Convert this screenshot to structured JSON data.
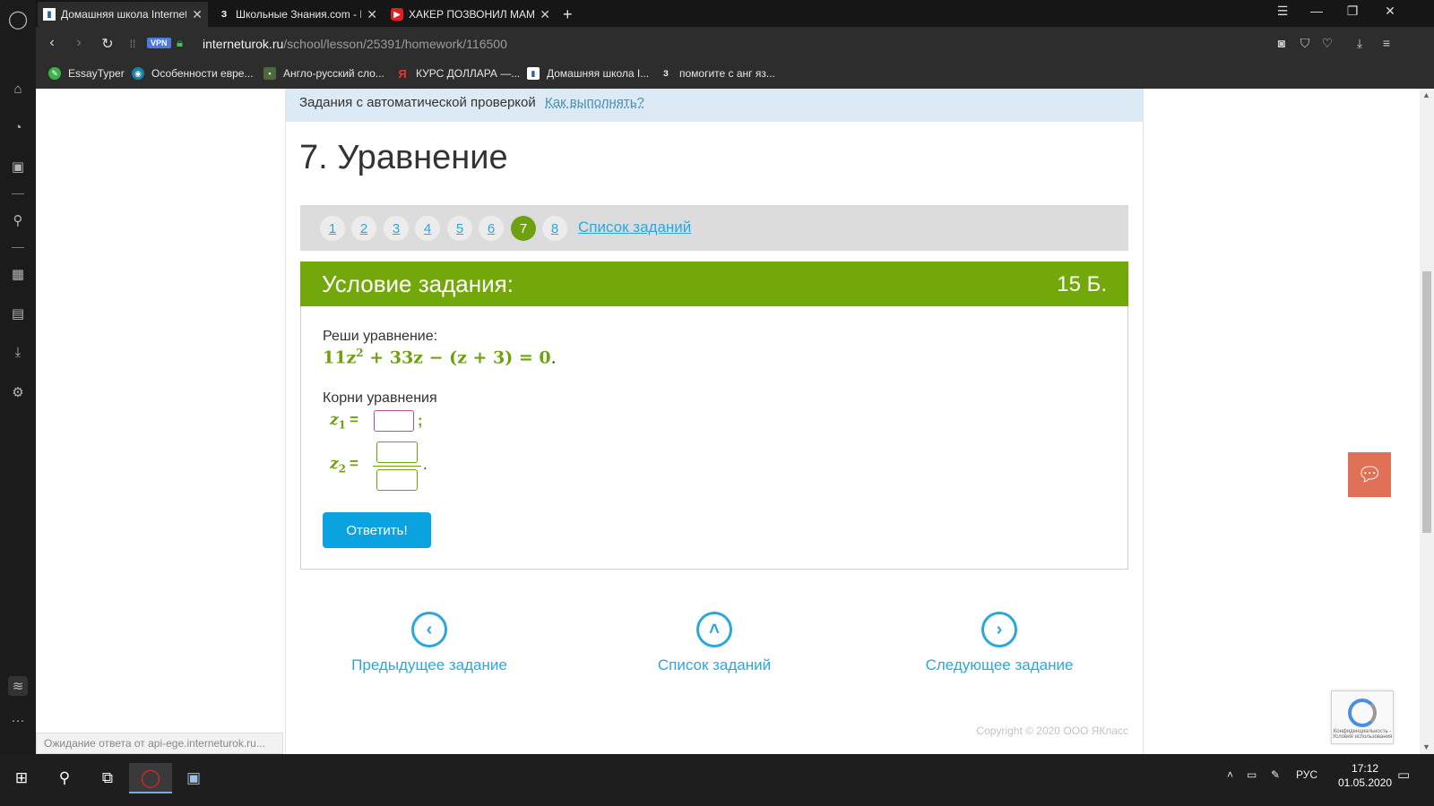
{
  "browser": {
    "tabs": [
      {
        "title": "Домашняя школа Internet",
        "favicon": "interneturok-favicon",
        "active": true
      },
      {
        "title": "Школьные Знания.com - Р",
        "favicon": "znanija-favicon",
        "active": false
      },
      {
        "title": "ХАКЕР ПОЗВОНИЛ МАМЕ",
        "favicon": "youtube-favicon",
        "active": false
      }
    ],
    "new_tab": "+",
    "vpn_badge": "VPN",
    "url_host": "interneturok.ru",
    "url_path": "/school/lesson/25391/homework/116500",
    "bookmarks": [
      {
        "label": "EssayTyper",
        "icon": "essaytyper-icon"
      },
      {
        "label": "Особенности евре...",
        "icon": "bookmark-globe-icon"
      },
      {
        "label": "Англо-русский сло...",
        "icon": "dictionary-icon"
      },
      {
        "label": "КУРС ДОЛЛАРА —...",
        "icon": "yandex-icon"
      },
      {
        "label": "Домашняя школа I...",
        "icon": "interneturok-favicon"
      },
      {
        "label": "помогите с анг яз...",
        "icon": "znanija-favicon"
      }
    ]
  },
  "page": {
    "info_text": "Задания с автоматической проверкой",
    "how_link": "Как выполнять?",
    "task_title": "7. Уравнение",
    "pager": [
      "1",
      "2",
      "3",
      "4",
      "5",
      "6",
      "7",
      "8"
    ],
    "current_page": "7",
    "task_list_link": "Список заданий",
    "condition_title": "Условие задания:",
    "points": "15 Б.",
    "solve_label": "Реши уравнение:",
    "equation_pre": "11z",
    "equation_exp": "2",
    "equation_post": " + 33z − (z + 3) = 0",
    "equation_end": ".",
    "roots_label": "Корни уравнения",
    "z1_label": "z",
    "z1_sub": "1",
    "z2_label": "z",
    "z2_sub": "2",
    "equals": "=",
    "z1_sep": ";",
    "z2_end": ".",
    "z1_value": "",
    "z2_num_value": "",
    "z2_den_value": "",
    "submit_label": "Ответить!",
    "prev_label": "Предыдущее задание",
    "list_label": "Список заданий",
    "next_label": "Следующее задание",
    "copyright": "Copyright © 2020 ООО ЯКласс",
    "status_text": "Ожидание ответа от api-ege.interneturok.ru...",
    "recaptcha_text": "Конфиденциальность - Условия использования"
  },
  "taskbar": {
    "lang": "РУС",
    "time": "17:12",
    "date": "01.05.2020"
  },
  "colors": {
    "accent_green": "#73a80a",
    "link_blue": "#29a8e0",
    "button_blue": "#0aa3e0",
    "info_bg": "#dbeaf4"
  }
}
